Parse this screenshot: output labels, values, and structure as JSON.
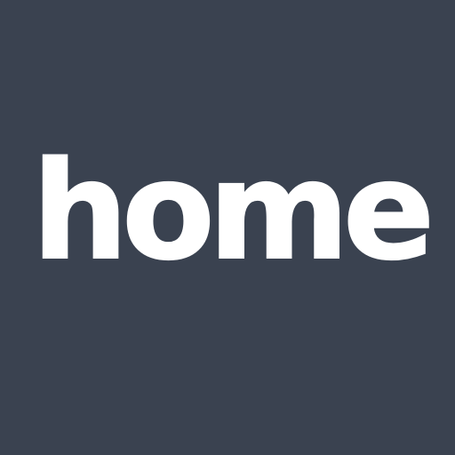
{
  "app_icon": {
    "wordmark": "home",
    "background_color": "#3a4250",
    "text_color": "#ffffff"
  }
}
